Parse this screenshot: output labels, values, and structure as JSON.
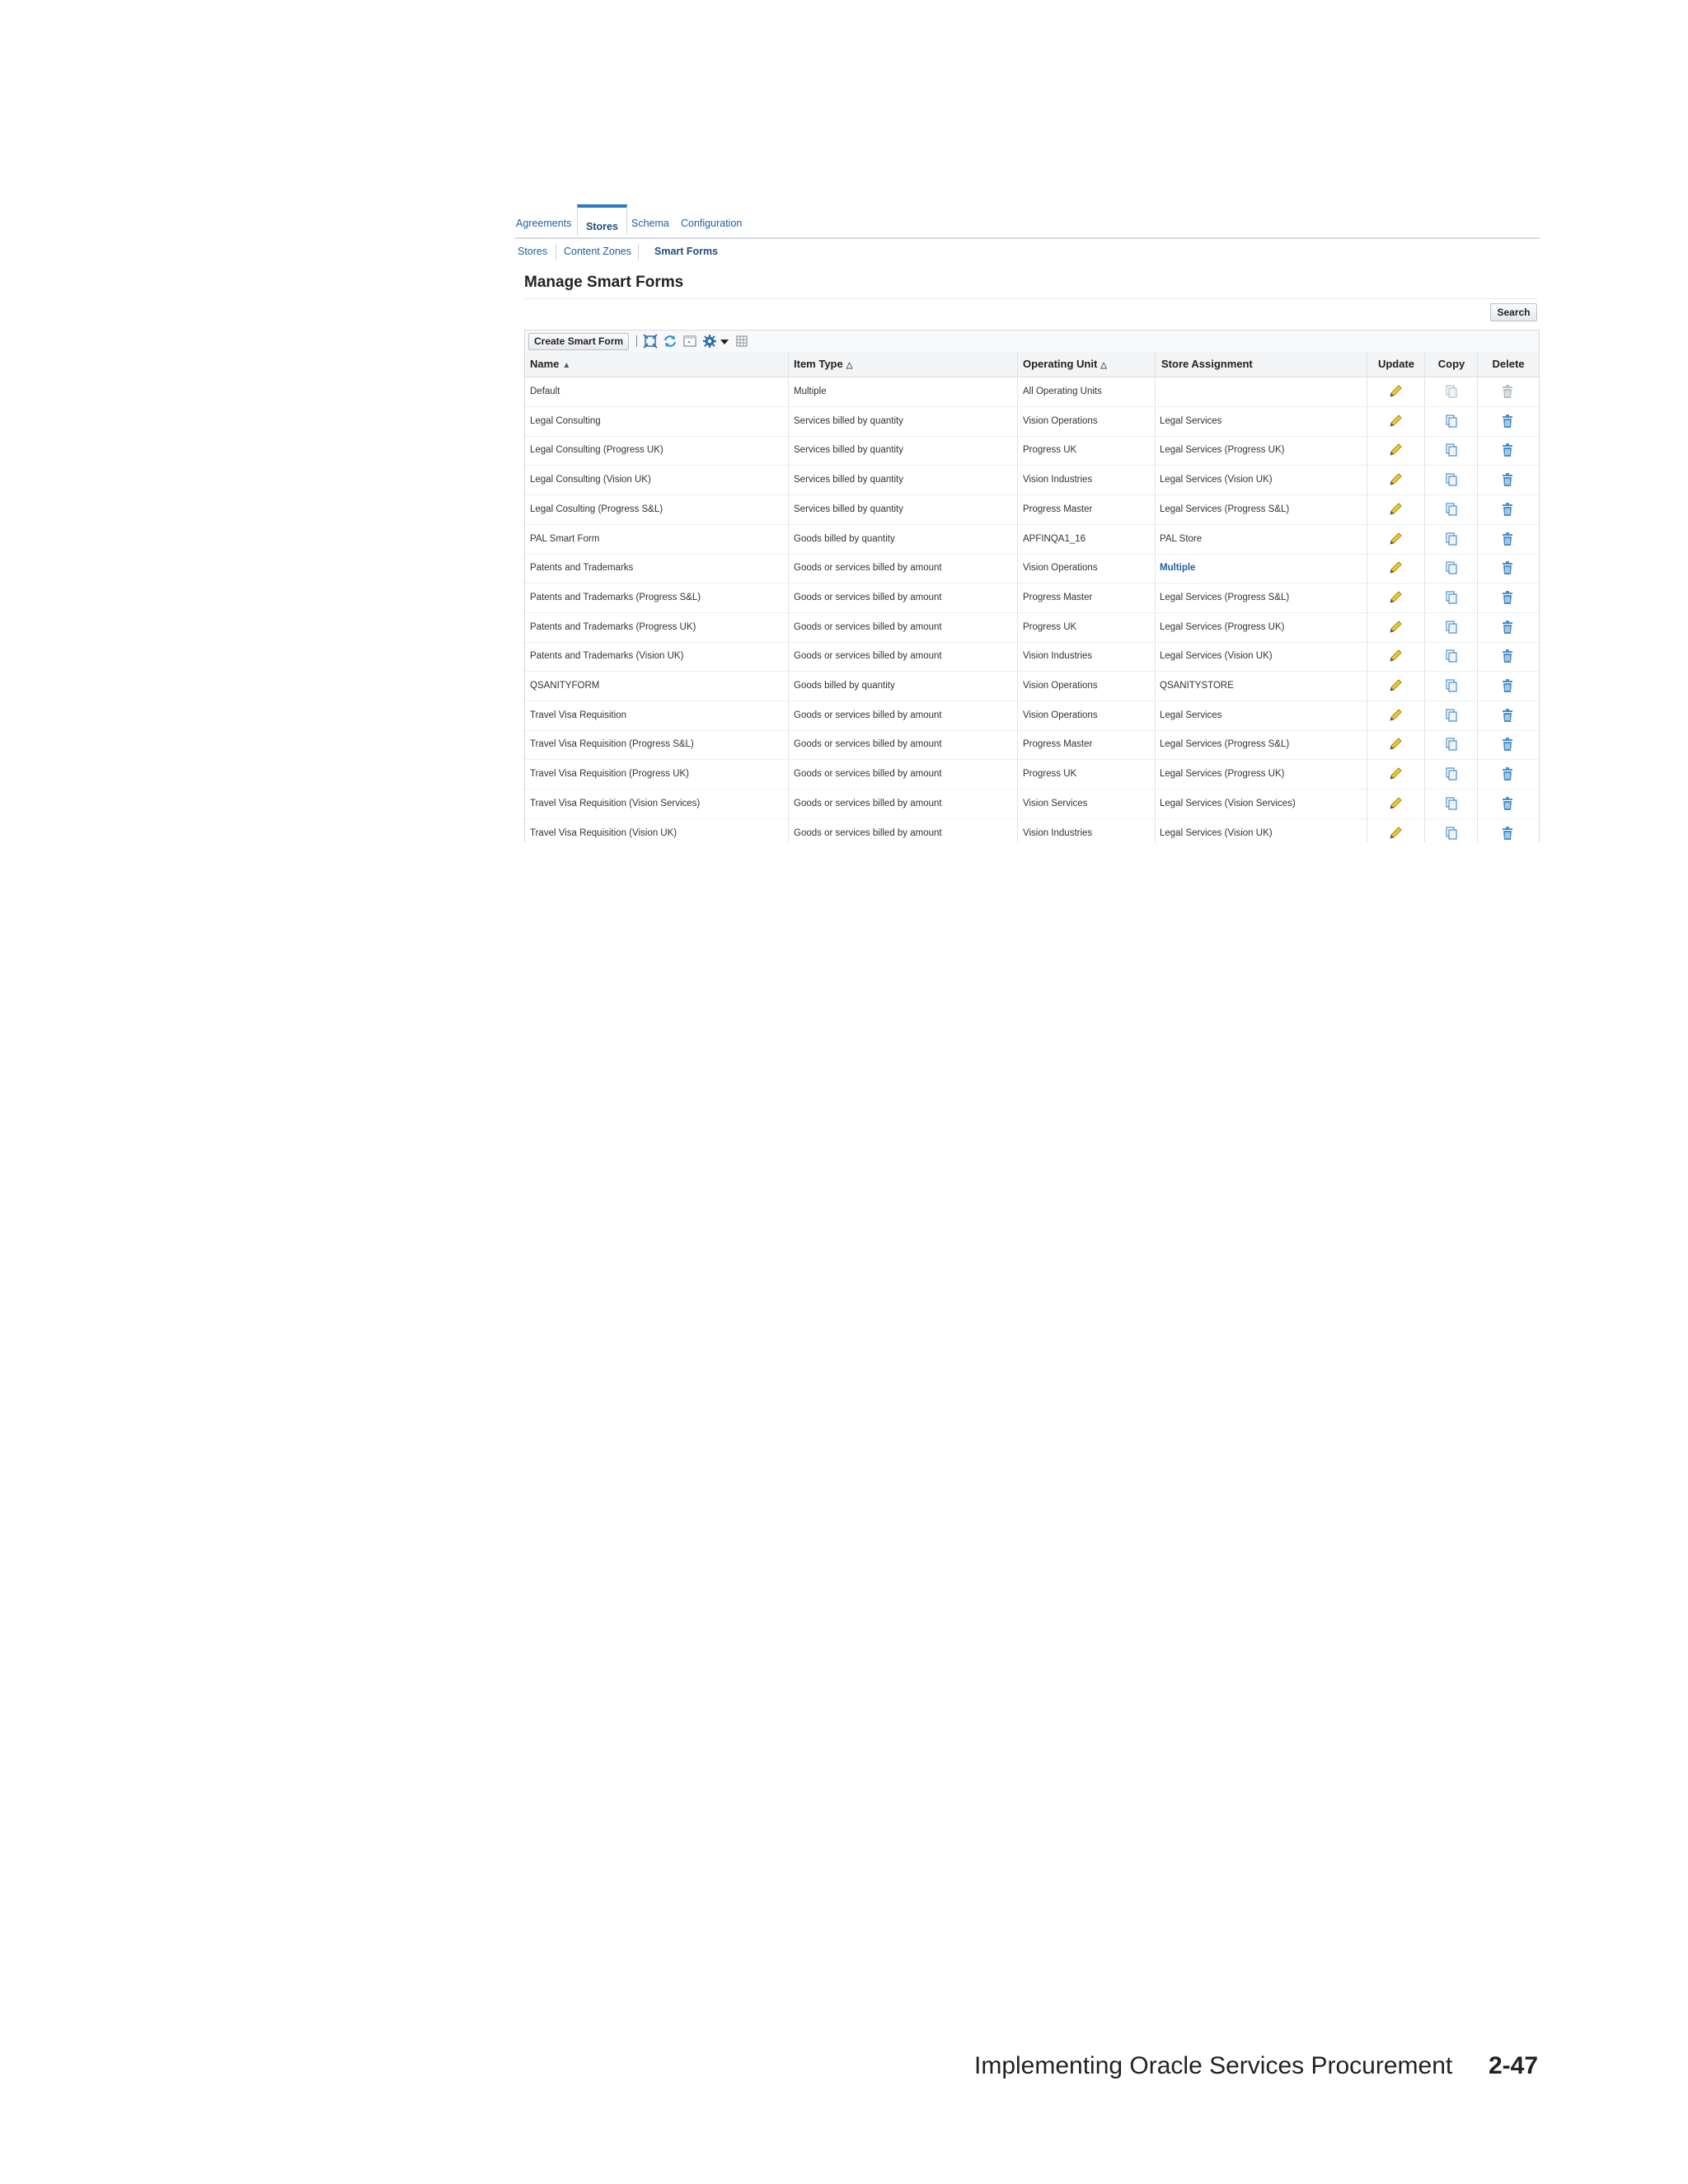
{
  "tabs": [
    {
      "label": "Agreements",
      "active": false
    },
    {
      "label": "Stores",
      "active": true
    },
    {
      "label": "Schema",
      "active": false
    },
    {
      "label": "Configuration",
      "active": false
    }
  ],
  "subtabs": [
    {
      "label": "Stores",
      "active": false
    },
    {
      "label": "Content Zones",
      "active": false
    },
    {
      "label": "Smart Forms",
      "active": true
    }
  ],
  "page": {
    "title": "Manage Smart Forms",
    "search_label": "Search",
    "create_label": "Create Smart Form"
  },
  "toolbar_icons": [
    "expand-icon",
    "refresh-icon",
    "detach-icon",
    "settings-icon",
    "dropdown-arrow-icon",
    "column-icon"
  ],
  "table": {
    "headers": {
      "name": "Name",
      "item_type": "Item Type",
      "operating_unit": "Operating Unit",
      "store_assignment": "Store Assignment",
      "update": "Update",
      "copy": "Copy",
      "delete": "Delete"
    },
    "sort": {
      "name": "ascending"
    },
    "rows": [
      {
        "name": "Default",
        "item_type": "Multiple",
        "operating_unit": "All Operating Units",
        "store": "",
        "store_link": false,
        "enabled": false
      },
      {
        "name": "Legal Consulting",
        "item_type": "Services billed by quantity",
        "operating_unit": "Vision Operations",
        "store": "Legal Services",
        "store_link": false,
        "enabled": true
      },
      {
        "name": "Legal Consulting (Progress UK)",
        "item_type": "Services billed by quantity",
        "operating_unit": "Progress UK",
        "store": "Legal Services (Progress UK)",
        "store_link": false,
        "enabled": true
      },
      {
        "name": "Legal Consulting (Vision UK)",
        "item_type": "Services billed by quantity",
        "operating_unit": "Vision Industries",
        "store": "Legal Services (Vision UK)",
        "store_link": false,
        "enabled": true
      },
      {
        "name": "Legal Cosulting (Progress S&L)",
        "item_type": "Services billed by quantity",
        "operating_unit": "Progress Master",
        "store": "Legal Services (Progress S&L)",
        "store_link": false,
        "enabled": true
      },
      {
        "name": "PAL Smart Form",
        "item_type": "Goods billed by quantity",
        "operating_unit": "APFINQA1_16",
        "store": "PAL Store",
        "store_link": false,
        "enabled": true
      },
      {
        "name": "Patents and Trademarks",
        "item_type": "Goods or services billed by amount",
        "operating_unit": "Vision Operations",
        "store": "Multiple",
        "store_link": true,
        "enabled": true
      },
      {
        "name": "Patents and Trademarks (Progress S&L)",
        "item_type": "Goods or services billed by amount",
        "operating_unit": "Progress Master",
        "store": "Legal Services (Progress S&L)",
        "store_link": false,
        "enabled": true
      },
      {
        "name": "Patents and Trademarks (Progress UK)",
        "item_type": "Goods or services billed by amount",
        "operating_unit": "Progress UK",
        "store": "Legal Services (Progress UK)",
        "store_link": false,
        "enabled": true
      },
      {
        "name": "Patents and Trademarks (Vision UK)",
        "item_type": "Goods or services billed by amount",
        "operating_unit": "Vision Industries",
        "store": "Legal Services (Vision UK)",
        "store_link": false,
        "enabled": true
      },
      {
        "name": "QSANITYFORM",
        "item_type": "Goods billed by quantity",
        "operating_unit": "Vision Operations",
        "store": "QSANITYSTORE",
        "store_link": false,
        "enabled": true
      },
      {
        "name": "Travel Visa Requisition",
        "item_type": "Goods or services billed by amount",
        "operating_unit": "Vision Operations",
        "store": "Legal Services",
        "store_link": false,
        "enabled": true
      },
      {
        "name": "Travel Visa Requisition (Progress S&L)",
        "item_type": "Goods or services billed by amount",
        "operating_unit": "Progress Master",
        "store": "Legal Services (Progress S&L)",
        "store_link": false,
        "enabled": true
      },
      {
        "name": "Travel Visa Requisition (Progress UK)",
        "item_type": "Goods or services billed by amount",
        "operating_unit": "Progress UK",
        "store": "Legal Services (Progress UK)",
        "store_link": false,
        "enabled": true
      },
      {
        "name": "Travel Visa Requisition (Vision Services)",
        "item_type": "Goods or services billed by amount",
        "operating_unit": "Vision Services",
        "store": "Legal Services (Vision Services)",
        "store_link": false,
        "enabled": true
      },
      {
        "name": "Travel Visa Requisition (Vision UK)",
        "item_type": "Goods or services billed by amount",
        "operating_unit": "Vision Industries",
        "store": "Legal Services (Vision UK)",
        "store_link": false,
        "enabled": true
      }
    ]
  },
  "footer": {
    "title": "Implementing Oracle Services Procurement",
    "page_number": "2-47"
  },
  "colors": {
    "link": "#1f5f9f",
    "active_tab_border": "#2a7bc0",
    "pencil": "#e8c21a",
    "icon_blue": "#4a90c8",
    "disabled": "#b8bec4"
  }
}
